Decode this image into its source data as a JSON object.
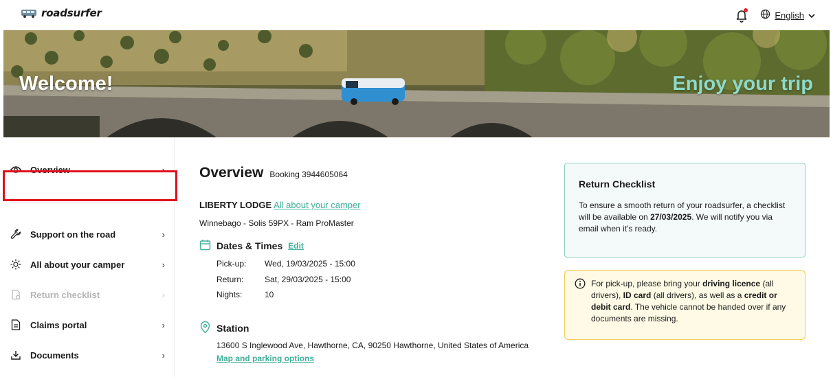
{
  "brand": {
    "name": "roadsurfer"
  },
  "header": {
    "language": "English"
  },
  "hero": {
    "welcome": "Welcome!",
    "tagline": "Enjoy your trip"
  },
  "sidebar": {
    "items": [
      {
        "label": "Overview",
        "icon": "eye-icon",
        "disabled": false
      },
      {
        "label": "Support on the road",
        "icon": "wrench-icon",
        "disabled": false
      },
      {
        "label": "All about your camper",
        "icon": "sun-icon",
        "disabled": false
      },
      {
        "label": "Return checklist",
        "icon": "checklist-icon",
        "disabled": true
      },
      {
        "label": "Claims portal",
        "icon": "document-icon",
        "disabled": false
      },
      {
        "label": "Documents",
        "icon": "download-icon",
        "disabled": false
      }
    ]
  },
  "main": {
    "title": "Overview",
    "booking": "Booking 3944605064",
    "camper_name": "LIBERTY LODGE",
    "camper_link": "All about your camper",
    "model": "Winnebago - Solis 59PX - Ram ProMaster",
    "dates": {
      "heading": "Dates & Times",
      "edit": "Edit",
      "pickup_label": "Pick-up:",
      "pickup_value": "Wed, 19/03/2025 - 15:00",
      "return_label": "Return:",
      "return_value": "Sat, 29/03/2025 - 15:00",
      "nights_label": "Nights:",
      "nights_value": "10"
    },
    "station": {
      "heading": "Station",
      "address": "13600 S Inglewood Ave, Hawthorne, CA, 90250 Hawthorne, United States of America",
      "link": "Map and parking options"
    }
  },
  "return_card": {
    "title": "Return Checklist",
    "text_1": "To ensure a smooth return of your roadsurfer, a checklist will be available on ",
    "date": "27/03/2025",
    "text_2": ". We will notify you via email when it's ready."
  },
  "info_card": {
    "t1": "For pick-up, please bring your ",
    "b1": "driving licence",
    "t2": " (all drivers), ",
    "b2": "ID card",
    "t3": " (all drivers), as well as a ",
    "b3": "credit or debit card",
    "t4": ". The vehicle cannot be handed over if any documents are missing."
  },
  "colors": {
    "accent": "#3eaf99",
    "highlight": "#e0101b",
    "warn_border": "#f0cd55",
    "check_border": "#8fd0c1"
  }
}
